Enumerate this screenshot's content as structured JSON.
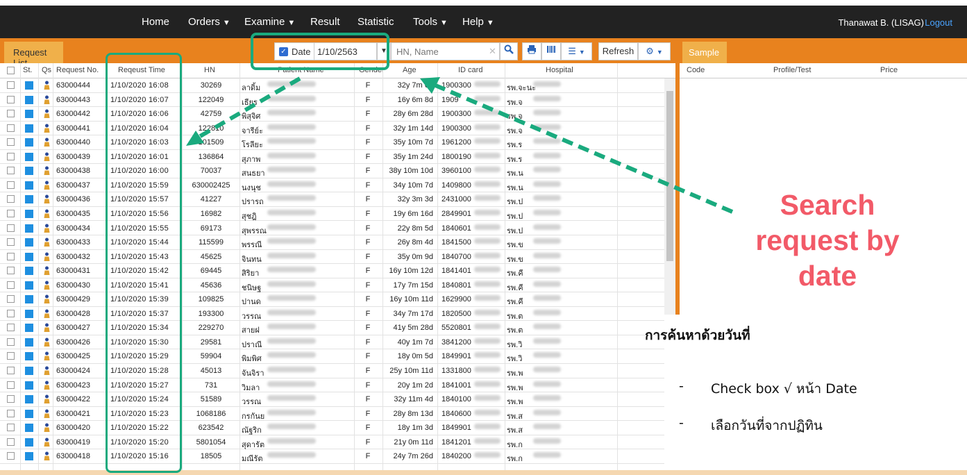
{
  "nav": {
    "items": [
      "Home",
      "Orders",
      "Examine",
      "Result",
      "Statistic",
      "Tools",
      "Help"
    ],
    "user": "Thanawat B. (LISAG)",
    "logout": "Logout"
  },
  "toolbar": {
    "tab": "Request List",
    "date_label": "Date",
    "date_value": "1/10/2563",
    "search_placeholder": "HN, Name",
    "refresh": "Refresh"
  },
  "sample": {
    "tab": "Sample",
    "headers": [
      "Code",
      "Profile/Test",
      "Price"
    ]
  },
  "table": {
    "headers": [
      "St.",
      "Qs",
      "Request No.",
      "Reqeust Time",
      "HN",
      "Patient Name",
      "Gender",
      "Age",
      "ID card",
      "Hospital"
    ],
    "rows": [
      [
        "63000444",
        "1/10/2020  16:08",
        "30269",
        "ลาดิ้ม",
        "F",
        "32y 7m 6d",
        "1900300",
        "รพ.จะนะ"
      ],
      [
        "63000443",
        "1/10/2020  16:07",
        "122049",
        "เธียร",
        "F",
        "16y 6m 8d",
        "1909",
        "รพ.จ"
      ],
      [
        "63000442",
        "1/10/2020  16:06",
        "42759",
        "พิสุจิศ",
        "F",
        "28y 6m 28d",
        "1900300",
        "รพ.จ"
      ],
      [
        "63000441",
        "1/10/2020  16:04",
        "122810",
        "จารีย์ะ",
        "F",
        "32y 1m 14d",
        "1900300",
        "รพ.จ"
      ],
      [
        "63000440",
        "1/10/2020  16:03",
        "101509",
        "โรลียะ",
        "F",
        "35y 10m 7d",
        "1961200",
        "รพ.ร"
      ],
      [
        "63000439",
        "1/10/2020  16:01",
        "136864",
        "สุภาพ",
        "F",
        "35y 1m 24d",
        "1800190",
        "รพ.ร"
      ],
      [
        "63000438",
        "1/10/2020  16:00",
        "70037",
        "สนธยา",
        "F",
        "38y 10m 10d",
        "3960100",
        "รพ.น"
      ],
      [
        "63000437",
        "1/10/2020  15:59",
        "630002425",
        "นงนุช",
        "F",
        "34y 10m 7d",
        "1409800",
        "รพ.น"
      ],
      [
        "63000436",
        "1/10/2020  15:57",
        "41227",
        "ปรารถ",
        "F",
        "32y 3m 3d",
        "2431000",
        "รพ.ป"
      ],
      [
        "63000435",
        "1/10/2020  15:56",
        "16982",
        "สุชฎิ",
        "F",
        "19y 6m 16d",
        "2849901",
        "รพ.ป"
      ],
      [
        "63000434",
        "1/10/2020  15:55",
        "69173",
        "สุพรรณ",
        "F",
        "22y 8m 5d",
        "1840601",
        "รพ.ป"
      ],
      [
        "63000433",
        "1/10/2020  15:44",
        "115599",
        "พรรณี",
        "F",
        "26y 8m 4d",
        "1841500",
        "รพ.ข"
      ],
      [
        "63000432",
        "1/10/2020  15:43",
        "45625",
        "จินทน",
        "F",
        "35y 0m 9d",
        "1840700",
        "รพ.ข"
      ],
      [
        "63000431",
        "1/10/2020  15:42",
        "69445",
        "สิริยา",
        "F",
        "16y 10m 12d",
        "1841401",
        "รพ.คี"
      ],
      [
        "63000430",
        "1/10/2020  15:41",
        "45636",
        "ชนิษฐ",
        "F",
        "17y 7m 15d",
        "1840801",
        "รพ.คี"
      ],
      [
        "63000429",
        "1/10/2020  15:39",
        "109825",
        "ปานด",
        "F",
        "16y 10m 11d",
        "1629900",
        "รพ.คี"
      ],
      [
        "63000428",
        "1/10/2020  15:37",
        "193300",
        "วรรณ",
        "F",
        "34y 7m 17d",
        "1820500",
        "รพ.ต"
      ],
      [
        "63000427",
        "1/10/2020  15:34",
        "229270",
        "สายฝ",
        "F",
        "41y 5m 28d",
        "5520801",
        "รพ.ต"
      ],
      [
        "63000426",
        "1/10/2020  15:30",
        "29581",
        "ปราณี",
        "F",
        "40y 1m 7d",
        "3841200",
        "รพ.วิ"
      ],
      [
        "63000425",
        "1/10/2020  15:29",
        "59904",
        "พิมพิศ",
        "F",
        "18y 0m 5d",
        "1849901",
        "รพ.วิ"
      ],
      [
        "63000424",
        "1/10/2020  15:28",
        "45013",
        "จันจิรา",
        "F",
        "25y 10m 11d",
        "1331800",
        "รพ.พ"
      ],
      [
        "63000423",
        "1/10/2020  15:27",
        "731",
        "วิมลา",
        "F",
        "20y 1m 2d",
        "1841001",
        "รพ.พ"
      ],
      [
        "63000422",
        "1/10/2020  15:24",
        "51589",
        "วรรณ",
        "F",
        "32y 11m 4d",
        "1840100",
        "รพ.พ"
      ],
      [
        "63000421",
        "1/10/2020  15:23",
        "1068186",
        "กรกันย",
        "F",
        "28y 8m 13d",
        "1840600",
        "รพ.ส"
      ],
      [
        "63000420",
        "1/10/2020  15:22",
        "623542",
        "ณัฐริก",
        "F",
        "18y 1m 3d",
        "1849901",
        "รพ.ส"
      ],
      [
        "63000419",
        "1/10/2020  15:20",
        "5801054",
        "สุดารัต",
        "F",
        "21y 0m 11d",
        "1841201",
        "รพ.ก"
      ],
      [
        "63000418",
        "1/10/2020  15:16",
        "18505",
        "มณีรัต",
        "F",
        "24y 7m 26d",
        "1840200",
        "รพ.ก"
      ]
    ]
  },
  "annotation": {
    "callout": [
      "Search",
      "request by",
      "date"
    ],
    "thai_title": "การค้นหาด้วยวันที่",
    "bullets": [
      "Check box √ หน้า Date",
      "เลือกวันที่จากปฏิทิน"
    ]
  },
  "colors": {
    "nav": "#222222",
    "orange": "#e8821e",
    "green": "#1aaa7e",
    "callout": "#f25a68",
    "status": "#1e8fe0"
  }
}
